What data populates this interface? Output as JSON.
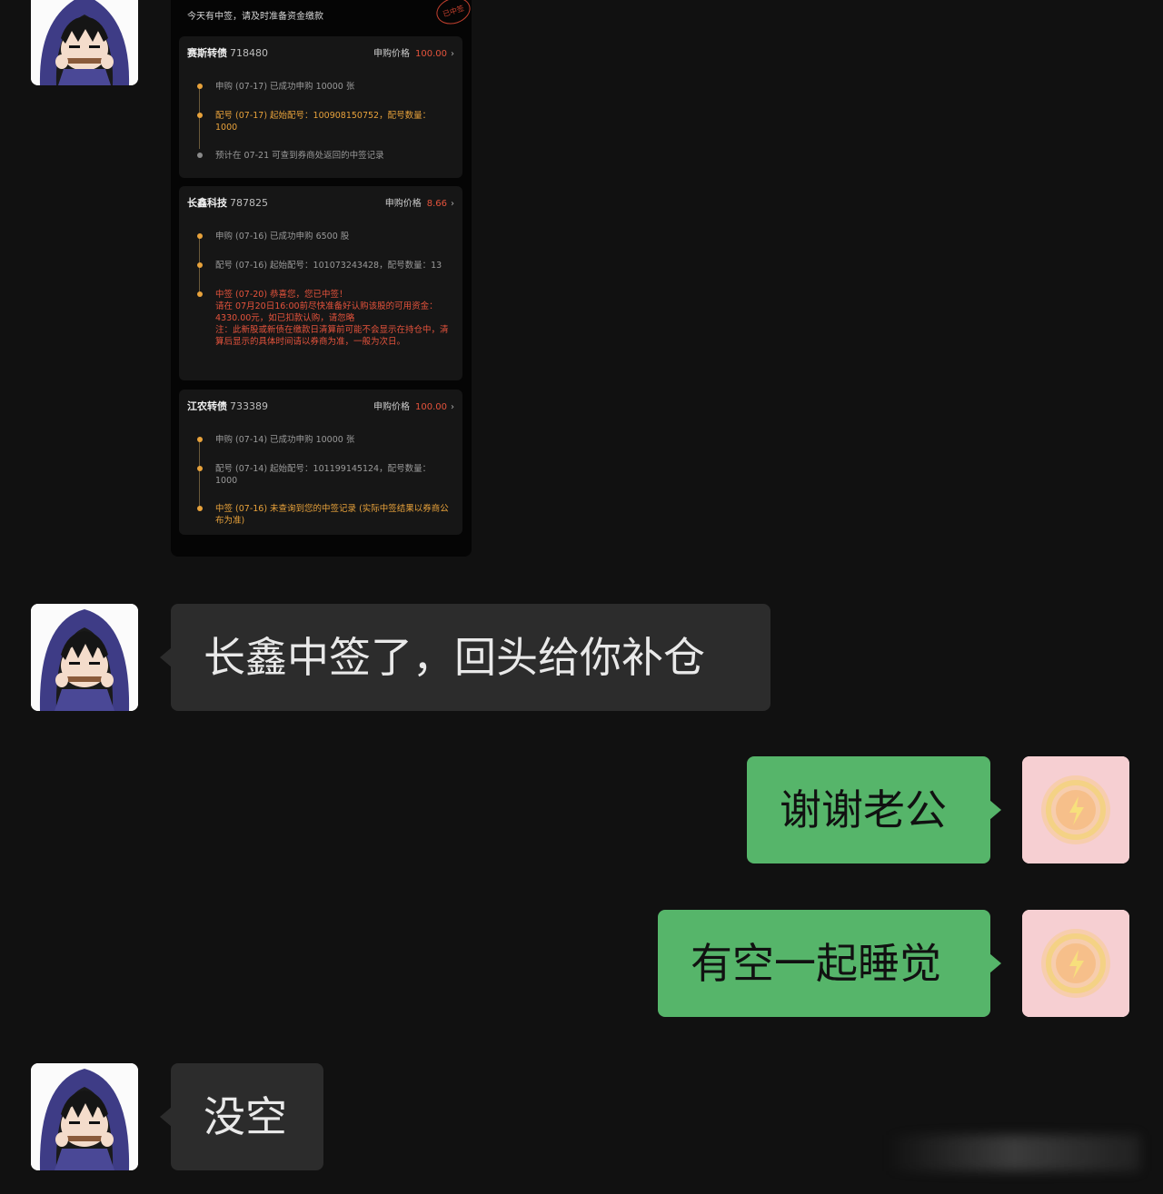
{
  "screenshot": {
    "notice": "今天有中签，请及时准备资金缴款",
    "stamp": "已中签",
    "cards": [
      {
        "name": "赛斯转债",
        "code": "718480",
        "price_label": "申购价格",
        "price": "100.00",
        "steps": [
          "申购 (07-17) 已成功申购 10000 张",
          "配号 (07-17) 起始配号：100908150752，配号数量：1000",
          "预计在 07-21 可查到券商处返回的中签记录"
        ]
      },
      {
        "name": "长鑫科技",
        "code": "787825",
        "price_label": "申购价格",
        "price": "8.66",
        "steps": [
          "申购 (07-16) 已成功申购 6500 股",
          "配号 (07-16) 起始配号：101073243428，配号数量：13",
          "中签 (07-20) 恭喜您，您已中签！",
          "请在 07月20日16:00前尽快准备好认购该股的可用资金：4330.00元，如已扣款认购，请忽略",
          "注：此新股或新债在缴款日清算前可能不会显示在持仓中，清算后显示的具体时间请以券商为准，一般为次日。"
        ]
      },
      {
        "name": "江农转债",
        "code": "733389",
        "price_label": "申购价格",
        "price": "100.00",
        "steps": [
          "申购 (07-14) 已成功申购 10000 张",
          "配号 (07-14) 起始配号：101199145124，配号数量：1000",
          "中签 (07-16) 未查询到您的中签记录 (实际中签结果以券商公布为准)"
        ]
      }
    ]
  },
  "messages": [
    {
      "side": "in",
      "text": "长鑫中签了，回头给你补仓"
    },
    {
      "side": "out",
      "text": "谢谢老公"
    },
    {
      "side": "out",
      "text": "有空一起睡觉"
    },
    {
      "side": "in",
      "text": "没空"
    }
  ],
  "colors": {
    "background": "#111111",
    "incoming_bubble": "#2c2c2c",
    "outgoing_bubble": "#56b56a",
    "price_red": "#e5533c",
    "step_orange": "#e8a23b"
  },
  "icons": {
    "contact_avatar": "hooded-anime-avatar-icon",
    "self_avatar": "glowing-orb-avatar-icon"
  }
}
